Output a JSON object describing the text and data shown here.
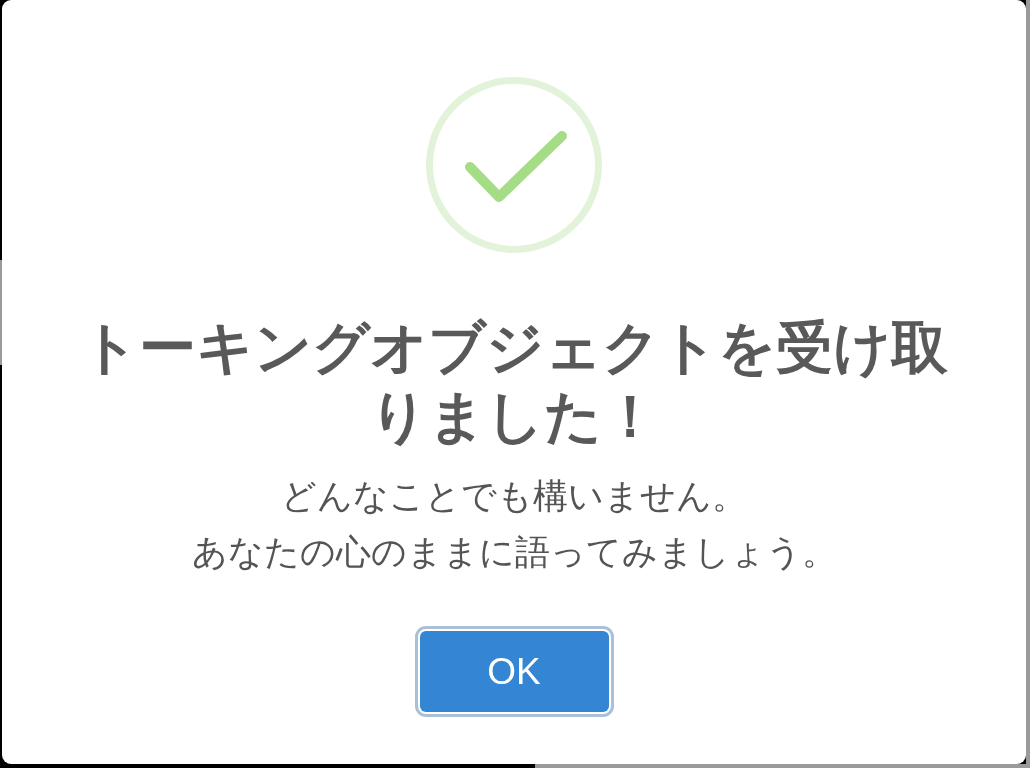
{
  "dialog": {
    "icon": {
      "kind": "success"
    },
    "title": "トーキングオブジェクトを受け取りました！",
    "message_lines": [
      "どんなことでも構いません。",
      "あなたの心のままに語ってみましょう。"
    ],
    "buttons": [
      {
        "label": "OK",
        "focused": true
      }
    ]
  }
}
